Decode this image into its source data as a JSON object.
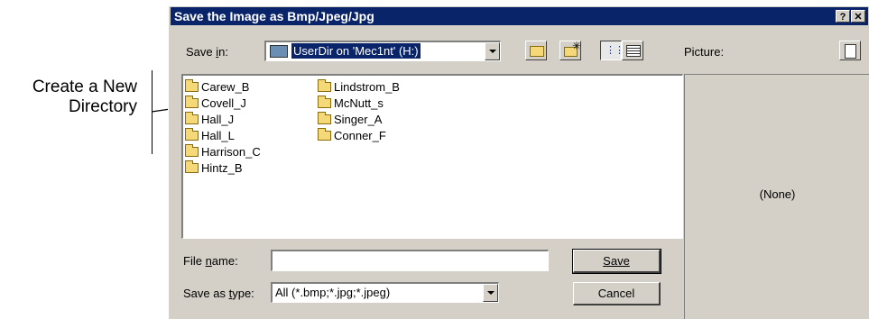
{
  "annotation": {
    "line1": "Create a New",
    "line2": "Directory"
  },
  "dialog": {
    "title": "Save the Image as Bmp/Jpeg/Jpg",
    "help_btn": "?",
    "close_btn": "✕",
    "save_in_label": "Save in:",
    "save_in_value": "UserDir on 'Mec1nt' (H:)",
    "picture_label": "Picture:",
    "preview_text": "(None)",
    "folders": [
      "Carew_B",
      "Covell_J",
      "Hall_J",
      "Hall_L",
      "Harrison_C",
      "Hintz_B",
      "Lindstrom_B",
      "McNutt_s",
      "Singer_A",
      "Conner_F"
    ],
    "file_name_label": "File name:",
    "file_name_value": "",
    "save_type_label": "Save as type:",
    "save_type_value": "All (*.bmp;*.jpg;*.jpeg)",
    "save_button": "Save",
    "cancel_button": "Cancel"
  }
}
